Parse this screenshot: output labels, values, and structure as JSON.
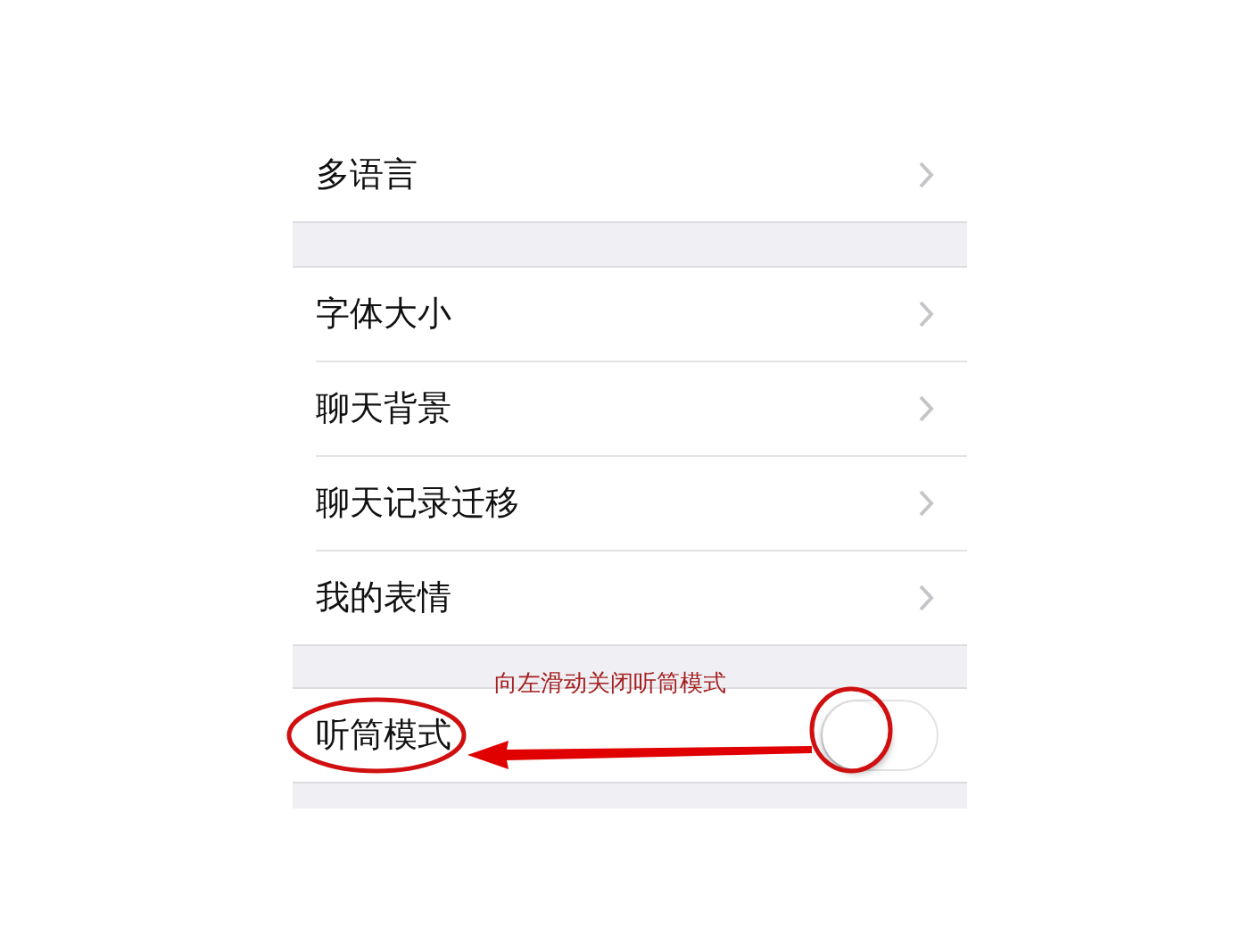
{
  "sections": [
    {
      "rows": [
        {
          "kind": "link",
          "label": "多语言"
        }
      ]
    },
    {
      "rows": [
        {
          "kind": "link",
          "label": "字体大小"
        },
        {
          "kind": "link",
          "label": "聊天背景"
        },
        {
          "kind": "link",
          "label": "聊天记录迁移"
        },
        {
          "kind": "link",
          "label": "我的表情"
        }
      ]
    },
    {
      "rows": [
        {
          "kind": "toggle",
          "label": "听筒模式",
          "on": false
        }
      ]
    }
  ],
  "annotation": {
    "note": "向左滑动关闭听筒模式"
  }
}
